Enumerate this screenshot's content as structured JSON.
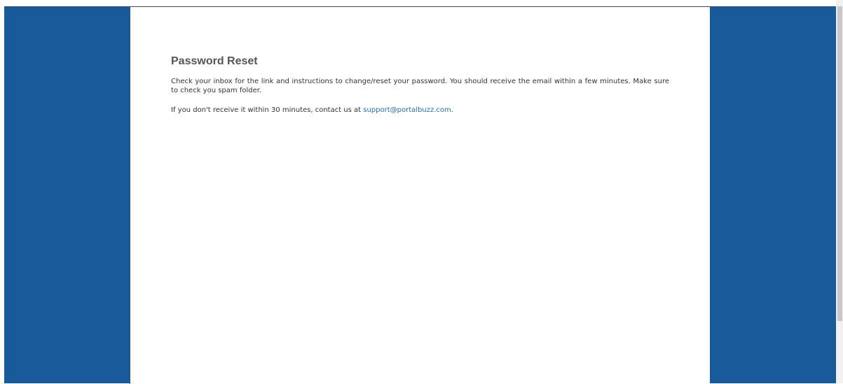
{
  "page": {
    "title": "Password Reset",
    "paragraph1": "Check your inbox for the link and instructions to change/reset your password. You should receive the email within a few minutes. Make sure to check you spam folder.",
    "paragraph2_prefix": "If you don't receive it within 30 minutes, contact us at ",
    "support_email": "support@portalbuzz.com",
    "paragraph2_suffix": "."
  },
  "colors": {
    "background_blue": "#195a9a",
    "panel": "#ffffff",
    "heading": "#555555",
    "link": "#2e6da4"
  }
}
